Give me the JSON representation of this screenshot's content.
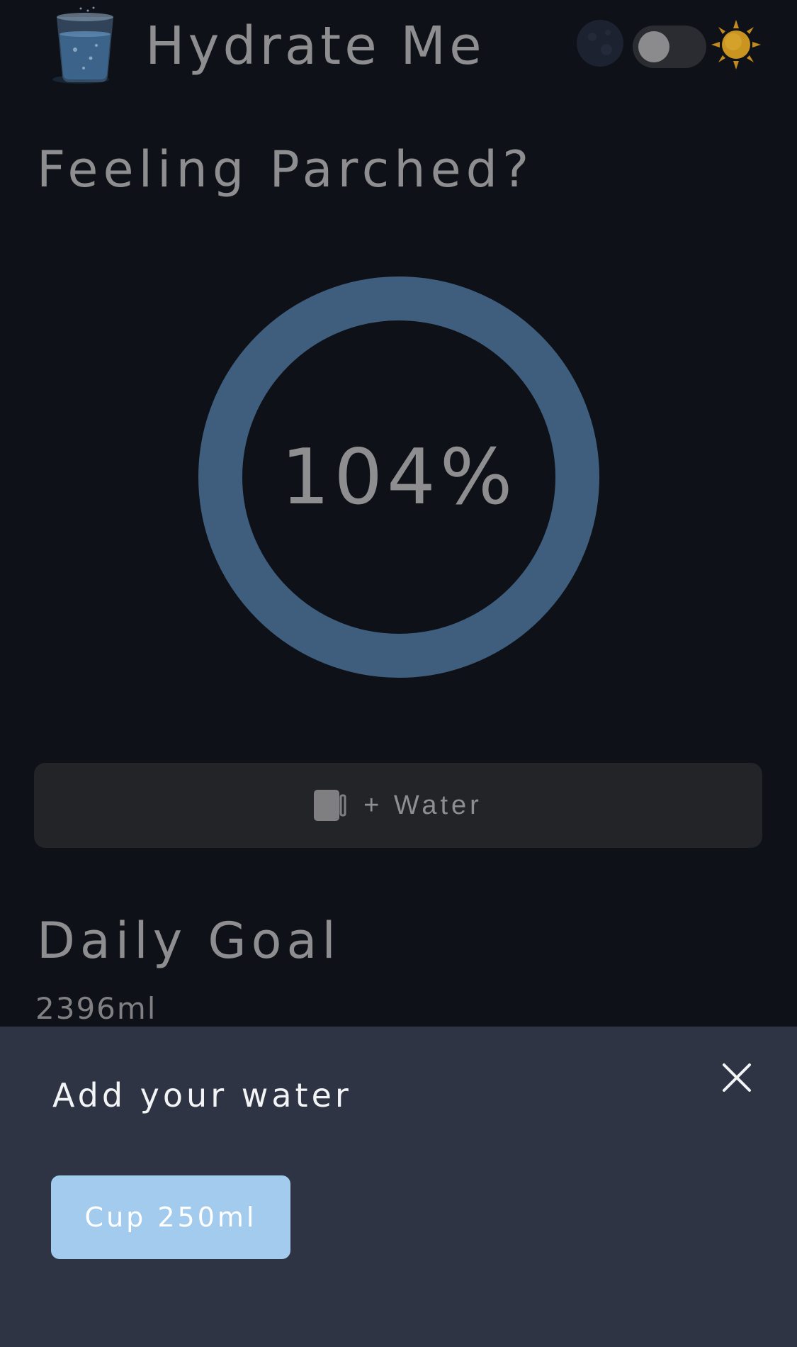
{
  "header": {
    "title": "Hydrate Me",
    "logo_icon": "water-glass-icon",
    "moon_icon": "moon-icon",
    "sun_icon": "sun-icon",
    "theme_toggle_on": false
  },
  "greeting": "Feeling Parched?",
  "progress": {
    "label": "104%",
    "fraction": 1.04,
    "ring_color": "#3f5e7d"
  },
  "add_water_button": {
    "icon": "mug-icon",
    "label": "+ Water"
  },
  "daily_goal": {
    "title": "Daily Goal",
    "value": "2396ml"
  },
  "sheet": {
    "title": "Add your water",
    "close_icon": "close-icon",
    "options": [
      {
        "label": "Cup 250ml",
        "color": "#a2cbee"
      }
    ]
  },
  "colors": {
    "background": "#0e1117",
    "sheet_background": "#2f3444",
    "button_background": "#232428"
  }
}
